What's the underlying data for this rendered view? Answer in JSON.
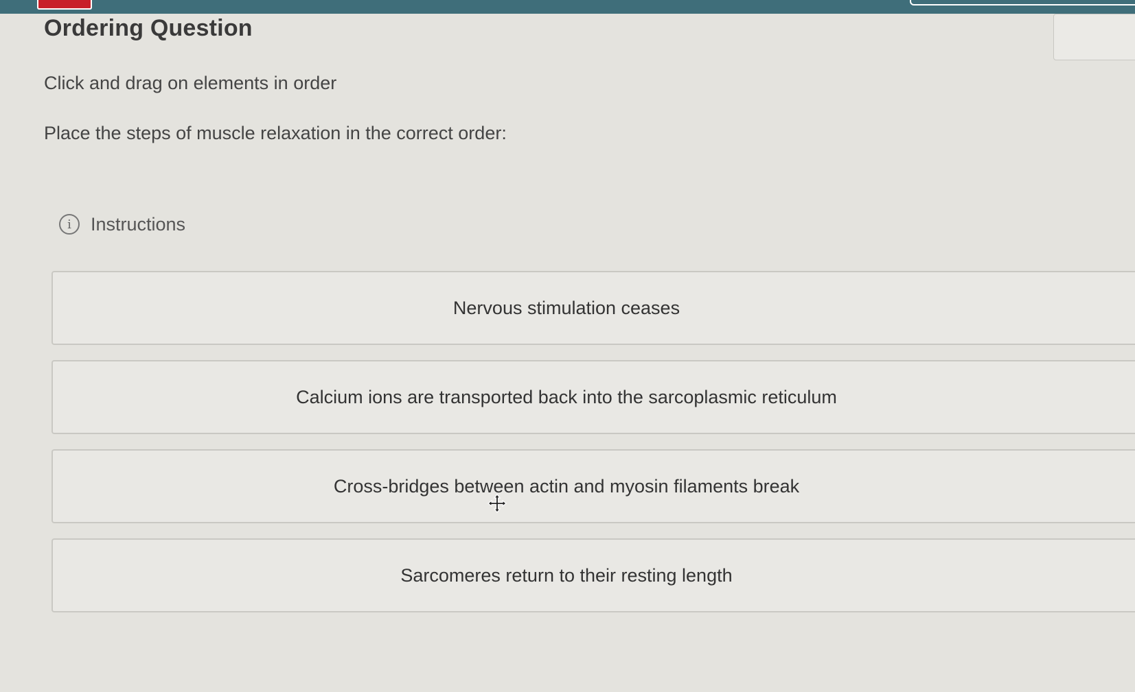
{
  "header": {
    "title": "Ordering Question"
  },
  "question": {
    "instruction": "Click and drag on elements in order",
    "prompt": "Place the steps of muscle relaxation in the correct order:",
    "instructions_toggle_label": "Instructions"
  },
  "order_items": [
    {
      "label": "Nervous stimulation ceases"
    },
    {
      "label": "Calcium ions are transported back into the sarcoplasmic reticulum"
    },
    {
      "label": "Cross-bridges between actin and myosin filaments break"
    },
    {
      "label": "Sarcomeres return to their resting length"
    }
  ],
  "icons": {
    "info": "info-icon",
    "cursor": "move-cursor-icon"
  },
  "colors": {
    "topbar": "#3f6e7a",
    "logo": "#c8202a",
    "background": "#e4e3de"
  }
}
